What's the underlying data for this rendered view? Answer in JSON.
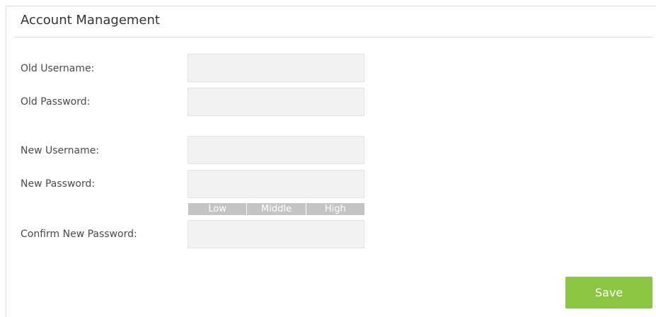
{
  "section": {
    "title": "Account Management"
  },
  "form": {
    "old_username_label": "Old Username:",
    "old_password_label": "Old Password:",
    "new_username_label": "New Username:",
    "new_password_label": "New Password:",
    "confirm_password_label": "Confirm New Password:",
    "old_username_value": "",
    "old_password_value": "",
    "new_username_value": "",
    "new_password_value": "",
    "confirm_password_value": ""
  },
  "strength": {
    "low": "Low",
    "middle": "Middle",
    "high": "High"
  },
  "actions": {
    "save_label": "Save"
  },
  "colors": {
    "save_button": "#8cc541",
    "strength_bar": "#c4c4c4",
    "field_background": "#f2f2f2"
  }
}
